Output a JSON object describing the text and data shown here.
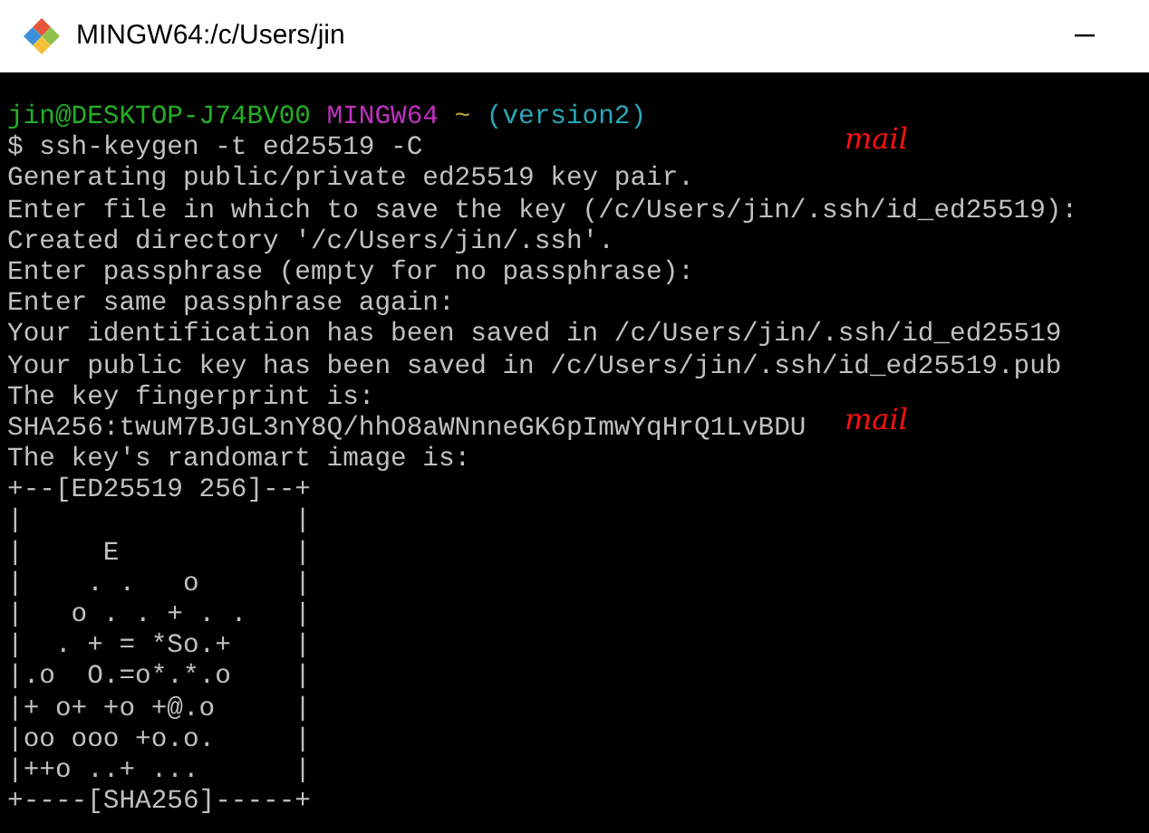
{
  "window": {
    "title": "MINGW64:/c/Users/jin"
  },
  "prompt": {
    "user_host": "jin@DESKTOP-J74BV00",
    "system": "MINGW64",
    "path": "~",
    "branch": "(version2)"
  },
  "lines": [
    {
      "text": "$ ssh-keygen -t ed25519 -C",
      "annotation": "mail"
    },
    {
      "text": "Generating public/private ed25519 key pair."
    },
    {
      "text": "Enter file in which to save the key (/c/Users/jin/.ssh/id_ed25519):"
    },
    {
      "text": "Created directory '/c/Users/jin/.ssh'."
    },
    {
      "text": "Enter passphrase (empty for no passphrase):"
    },
    {
      "text": "Enter same passphrase again:"
    },
    {
      "text": "Your identification has been saved in /c/Users/jin/.ssh/id_ed25519"
    },
    {
      "text": "Your public key has been saved in /c/Users/jin/.ssh/id_ed25519.pub"
    },
    {
      "text": "The key fingerprint is:"
    },
    {
      "text": "SHA256:twuM7BJGL3nY8Q/hhO8aWNnneGK6pImwYqHrQ1LvBDU",
      "annotation": "mail"
    },
    {
      "text": "The key's randomart image is:"
    },
    {
      "text": "+--[ED25519 256]--+"
    },
    {
      "text": "|                 |"
    },
    {
      "text": "|     E           |"
    },
    {
      "text": "|    . .   o      |"
    },
    {
      "text": "|   o . . + . .   |"
    },
    {
      "text": "|  . + = *So.+    |"
    },
    {
      "text": "|.o  O.=o*.*.o    |"
    },
    {
      "text": "|+ o+ +o +@.o     |"
    },
    {
      "text": "|oo ooo +o.o.     |"
    },
    {
      "text": "|++o ..+ ...      |"
    },
    {
      "text": "+----[SHA256]-----+"
    }
  ]
}
